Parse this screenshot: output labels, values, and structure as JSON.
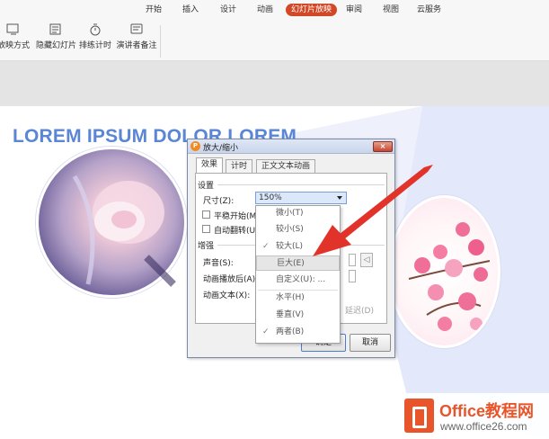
{
  "ribbon": {
    "tabs": [
      "开始",
      "插入",
      "设计",
      "动画",
      "幻灯片放映",
      "审阅",
      "视图",
      "云服务"
    ],
    "active_tab": "幻灯片放映",
    "tools": [
      {
        "label": "放映方式",
        "icon": "slideshow-settings-icon"
      },
      {
        "label": "隐藏幻灯片",
        "icon": "hide-slide-icon"
      },
      {
        "label": "排练计时",
        "icon": "timer-icon"
      },
      {
        "label": "演讲者备注",
        "icon": "speaker-notes-icon"
      }
    ]
  },
  "slide": {
    "title": "LOREM IPSUM DOLOR LOREM"
  },
  "dialog": {
    "title": "放大/缩小",
    "close": "×",
    "tabs": [
      "效果",
      "计时",
      "正文文本动画"
    ],
    "active_tab": "效果",
    "settings_label": "设置",
    "size_label": "尺寸(Z):",
    "size_value": "150%",
    "smooth_start": "平稳开始(M)",
    "auto_reverse": "自动翻转(U)",
    "enhance_label": "增强",
    "sound_label": "声音(S):",
    "after_anim_label": "动画播放后(A):",
    "anim_text_label": "动画文本(X):",
    "delay_suffix": "延迟(D)",
    "ok": "确定",
    "cancel": "取消"
  },
  "dropdown": {
    "items": [
      {
        "label": "微小(T)",
        "checked": false
      },
      {
        "label": "较小(S)",
        "checked": false
      },
      {
        "label": "较大(L)",
        "checked": true
      },
      {
        "label": "巨大(E)",
        "checked": false,
        "highlight": true
      },
      {
        "label": "自定义(U): ...",
        "checked": false
      },
      {
        "label": "水平(H)",
        "checked": false
      },
      {
        "label": "垂直(V)",
        "checked": false
      },
      {
        "label": "两者(B)",
        "checked": true
      }
    ],
    "check_glyph": "✓"
  },
  "watermark": {
    "line1": "Office教程网",
    "line2": "www.office26.com"
  },
  "colors": {
    "accent": "#d24726",
    "title_blue": "#5b86d6",
    "arrow_red": "#e2332b"
  }
}
